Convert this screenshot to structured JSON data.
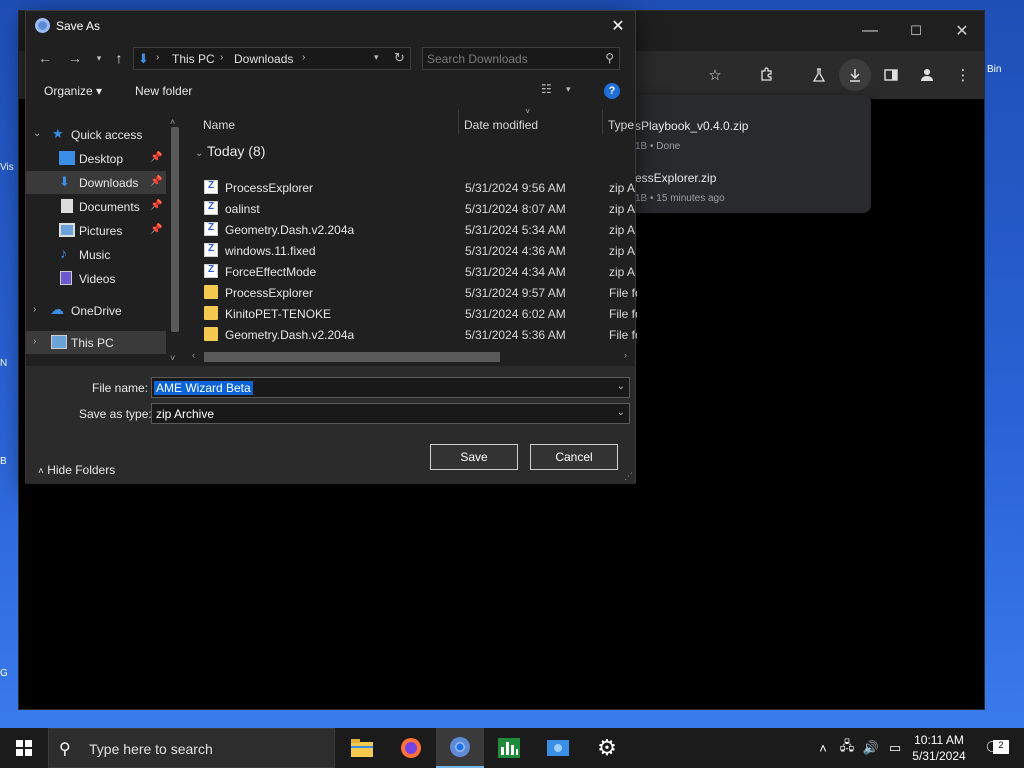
{
  "desktop": {
    "left_edge_labels": [
      "Vis",
      "N",
      "B",
      "G"
    ],
    "recycle_bin_label": "Bin"
  },
  "browser": {
    "minimize_glyph": "—",
    "maximize_glyph": "☐",
    "close_glyph": "✕",
    "downloads": [
      {
        "name": "sPlaybook_v0.4.0.zip",
        "status": "1B • Done"
      },
      {
        "name": "essExplorer.zip",
        "status": "1B • 15 minutes ago"
      }
    ]
  },
  "dialog": {
    "title": "Save As",
    "close_glyph": "✕",
    "address": {
      "segments": [
        "This PC",
        "Downloads"
      ],
      "separator": "›"
    },
    "search": {
      "placeholder": "Search Downloads"
    },
    "commands": {
      "organize": "Organize ▾",
      "new_folder": "New folder",
      "help": "?"
    },
    "nav_pane": {
      "quick_access": "Quick access",
      "items": [
        {
          "label": "Desktop",
          "pinned": true
        },
        {
          "label": "Downloads",
          "pinned": true,
          "selected": true
        },
        {
          "label": "Documents",
          "pinned": true
        },
        {
          "label": "Pictures",
          "pinned": true
        },
        {
          "label": "Music",
          "pinned": false
        },
        {
          "label": "Videos",
          "pinned": false
        }
      ],
      "onedrive": "OneDrive",
      "this_pc": "This PC"
    },
    "columns": {
      "name": "Name",
      "date": "Date modified",
      "type": "Type"
    },
    "group_header": "Today (8)",
    "files": [
      {
        "name": "ProcessExplorer",
        "date": "5/31/2024 9:56 AM",
        "type": "zip A",
        "kind": "zip"
      },
      {
        "name": "oalinst",
        "date": "5/31/2024 8:07 AM",
        "type": "zip A",
        "kind": "zip"
      },
      {
        "name": "Geometry.Dash.v2.204a",
        "date": "5/31/2024 5:34 AM",
        "type": "zip A",
        "kind": "zip"
      },
      {
        "name": "windows.11.fixed",
        "date": "5/31/2024 4:36 AM",
        "type": "zip A",
        "kind": "zip"
      },
      {
        "name": "ForceEffectMode",
        "date": "5/31/2024 4:34 AM",
        "type": "zip A",
        "kind": "zip"
      },
      {
        "name": "ProcessExplorer",
        "date": "5/31/2024 9:57 AM",
        "type": "File fo",
        "kind": "folder"
      },
      {
        "name": "KinitoPET-TENOKE",
        "date": "5/31/2024 6:02 AM",
        "type": "File fo",
        "kind": "folder"
      },
      {
        "name": "Geometry.Dash.v2.204a",
        "date": "5/31/2024 5:36 AM",
        "type": "File fo",
        "kind": "folder"
      }
    ],
    "file_name_label": "File name:",
    "file_name_value": "AME Wizard Beta",
    "save_as_type_label": "Save as type:",
    "save_as_type_value": "zip Archive",
    "save_button": "Save",
    "cancel_button": "Cancel",
    "hide_folders": "Hide Folders"
  },
  "taskbar": {
    "search_text": "Type here to search",
    "clock_time": "10:11 AM",
    "clock_date": "5/31/2024",
    "notification_count": "2"
  }
}
